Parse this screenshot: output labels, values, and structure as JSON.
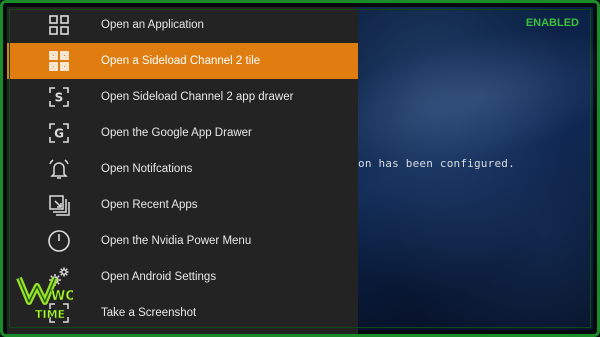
{
  "status": {
    "label": "ENABLED",
    "color": "#3cbf3c"
  },
  "background": {
    "console_text": "on has been configured."
  },
  "menu": {
    "selected_color": "#e07d10",
    "items": [
      {
        "label": "Open an Application",
        "icon": "app-grid-icon"
      },
      {
        "label": "Open a Sideload Channel 2 tile",
        "icon": "tile-grid-icon",
        "selected": true
      },
      {
        "label": "Open Sideload Channel 2 app drawer",
        "icon": "s-drawer-icon"
      },
      {
        "label": "Open the Google App Drawer",
        "icon": "g-drawer-icon"
      },
      {
        "label": "Open Notifcations",
        "icon": "bell-icon"
      },
      {
        "label": "Open Recent Apps",
        "icon": "recent-apps-icon"
      },
      {
        "label": "Open the Nvidia Power Menu",
        "icon": "power-icon"
      },
      {
        "label": "Open Android Settings",
        "icon": "gears-icon"
      },
      {
        "label": "Take a Screenshot",
        "icon": "screenshot-icon"
      }
    ]
  },
  "logo": {
    "text_top": "WOT",
    "text_bottom": "TIME"
  }
}
